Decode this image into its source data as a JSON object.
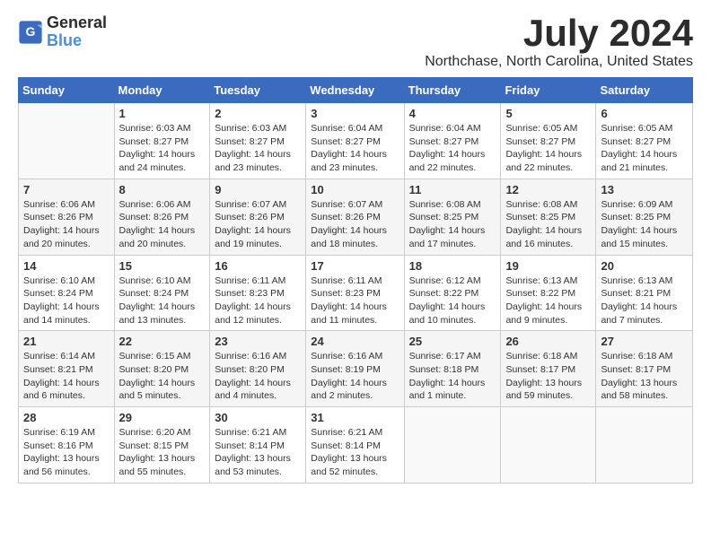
{
  "logo": {
    "line1": "General",
    "line2": "Blue"
  },
  "title": "July 2024",
  "subtitle": "Northchase, North Carolina, United States",
  "days_of_week": [
    "Sunday",
    "Monday",
    "Tuesday",
    "Wednesday",
    "Thursday",
    "Friday",
    "Saturday"
  ],
  "weeks": [
    [
      {
        "day": "",
        "content": ""
      },
      {
        "day": "1",
        "content": "Sunrise: 6:03 AM\nSunset: 8:27 PM\nDaylight: 14 hours\nand 24 minutes."
      },
      {
        "day": "2",
        "content": "Sunrise: 6:03 AM\nSunset: 8:27 PM\nDaylight: 14 hours\nand 23 minutes."
      },
      {
        "day": "3",
        "content": "Sunrise: 6:04 AM\nSunset: 8:27 PM\nDaylight: 14 hours\nand 23 minutes."
      },
      {
        "day": "4",
        "content": "Sunrise: 6:04 AM\nSunset: 8:27 PM\nDaylight: 14 hours\nand 22 minutes."
      },
      {
        "day": "5",
        "content": "Sunrise: 6:05 AM\nSunset: 8:27 PM\nDaylight: 14 hours\nand 22 minutes."
      },
      {
        "day": "6",
        "content": "Sunrise: 6:05 AM\nSunset: 8:27 PM\nDaylight: 14 hours\nand 21 minutes."
      }
    ],
    [
      {
        "day": "7",
        "content": "Sunrise: 6:06 AM\nSunset: 8:26 PM\nDaylight: 14 hours\nand 20 minutes."
      },
      {
        "day": "8",
        "content": "Sunrise: 6:06 AM\nSunset: 8:26 PM\nDaylight: 14 hours\nand 20 minutes."
      },
      {
        "day": "9",
        "content": "Sunrise: 6:07 AM\nSunset: 8:26 PM\nDaylight: 14 hours\nand 19 minutes."
      },
      {
        "day": "10",
        "content": "Sunrise: 6:07 AM\nSunset: 8:26 PM\nDaylight: 14 hours\nand 18 minutes."
      },
      {
        "day": "11",
        "content": "Sunrise: 6:08 AM\nSunset: 8:25 PM\nDaylight: 14 hours\nand 17 minutes."
      },
      {
        "day": "12",
        "content": "Sunrise: 6:08 AM\nSunset: 8:25 PM\nDaylight: 14 hours\nand 16 minutes."
      },
      {
        "day": "13",
        "content": "Sunrise: 6:09 AM\nSunset: 8:25 PM\nDaylight: 14 hours\nand 15 minutes."
      }
    ],
    [
      {
        "day": "14",
        "content": "Sunrise: 6:10 AM\nSunset: 8:24 PM\nDaylight: 14 hours\nand 14 minutes."
      },
      {
        "day": "15",
        "content": "Sunrise: 6:10 AM\nSunset: 8:24 PM\nDaylight: 14 hours\nand 13 minutes."
      },
      {
        "day": "16",
        "content": "Sunrise: 6:11 AM\nSunset: 8:23 PM\nDaylight: 14 hours\nand 12 minutes."
      },
      {
        "day": "17",
        "content": "Sunrise: 6:11 AM\nSunset: 8:23 PM\nDaylight: 14 hours\nand 11 minutes."
      },
      {
        "day": "18",
        "content": "Sunrise: 6:12 AM\nSunset: 8:22 PM\nDaylight: 14 hours\nand 10 minutes."
      },
      {
        "day": "19",
        "content": "Sunrise: 6:13 AM\nSunset: 8:22 PM\nDaylight: 14 hours\nand 9 minutes."
      },
      {
        "day": "20",
        "content": "Sunrise: 6:13 AM\nSunset: 8:21 PM\nDaylight: 14 hours\nand 7 minutes."
      }
    ],
    [
      {
        "day": "21",
        "content": "Sunrise: 6:14 AM\nSunset: 8:21 PM\nDaylight: 14 hours\nand 6 minutes."
      },
      {
        "day": "22",
        "content": "Sunrise: 6:15 AM\nSunset: 8:20 PM\nDaylight: 14 hours\nand 5 minutes."
      },
      {
        "day": "23",
        "content": "Sunrise: 6:16 AM\nSunset: 8:20 PM\nDaylight: 14 hours\nand 4 minutes."
      },
      {
        "day": "24",
        "content": "Sunrise: 6:16 AM\nSunset: 8:19 PM\nDaylight: 14 hours\nand 2 minutes."
      },
      {
        "day": "25",
        "content": "Sunrise: 6:17 AM\nSunset: 8:18 PM\nDaylight: 14 hours\nand 1 minute."
      },
      {
        "day": "26",
        "content": "Sunrise: 6:18 AM\nSunset: 8:17 PM\nDaylight: 13 hours\nand 59 minutes."
      },
      {
        "day": "27",
        "content": "Sunrise: 6:18 AM\nSunset: 8:17 PM\nDaylight: 13 hours\nand 58 minutes."
      }
    ],
    [
      {
        "day": "28",
        "content": "Sunrise: 6:19 AM\nSunset: 8:16 PM\nDaylight: 13 hours\nand 56 minutes."
      },
      {
        "day": "29",
        "content": "Sunrise: 6:20 AM\nSunset: 8:15 PM\nDaylight: 13 hours\nand 55 minutes."
      },
      {
        "day": "30",
        "content": "Sunrise: 6:21 AM\nSunset: 8:14 PM\nDaylight: 13 hours\nand 53 minutes."
      },
      {
        "day": "31",
        "content": "Sunrise: 6:21 AM\nSunset: 8:14 PM\nDaylight: 13 hours\nand 52 minutes."
      },
      {
        "day": "",
        "content": ""
      },
      {
        "day": "",
        "content": ""
      },
      {
        "day": "",
        "content": ""
      }
    ]
  ]
}
